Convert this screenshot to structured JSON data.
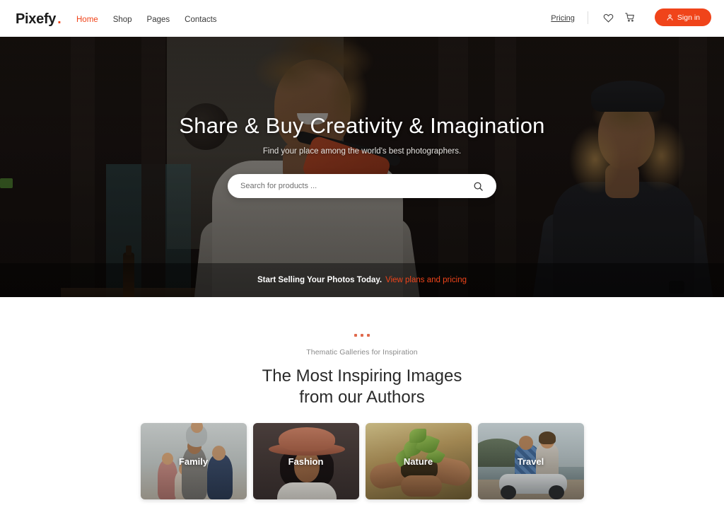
{
  "header": {
    "logo_text": "Pixefy",
    "logo_dot": ".",
    "nav": [
      {
        "label": "Home",
        "active": true
      },
      {
        "label": "Shop",
        "active": false
      },
      {
        "label": "Pages",
        "active": false
      },
      {
        "label": "Contacts",
        "active": false
      }
    ],
    "pricing_label": "Pricing",
    "wishlist_icon": "heart-icon",
    "cart_icon": "shopping-cart-icon",
    "signin_label": "Sign in",
    "signin_icon": "user-icon",
    "accent_color": "#f0441a"
  },
  "hero": {
    "title": "Share & Buy Creativity & Imagination",
    "subtitle": "Find your place among the world's best photographers.",
    "search": {
      "placeholder": "Search for products ...",
      "value": "",
      "icon": "search-icon"
    },
    "banner": {
      "text": "Start Selling Your Photos Today.",
      "link_label": "View plans and pricing",
      "link_color": "#f0441a"
    }
  },
  "gallery": {
    "eyebrow": "Thematic Galleries for Inspiration",
    "title_line1": "The Most Inspiring Images",
    "title_line2": "from our Authors",
    "dots_color": "#e06a4d",
    "cards": [
      {
        "label": "Family"
      },
      {
        "label": "Fashion"
      },
      {
        "label": "Nature"
      },
      {
        "label": "Travel"
      }
    ]
  }
}
